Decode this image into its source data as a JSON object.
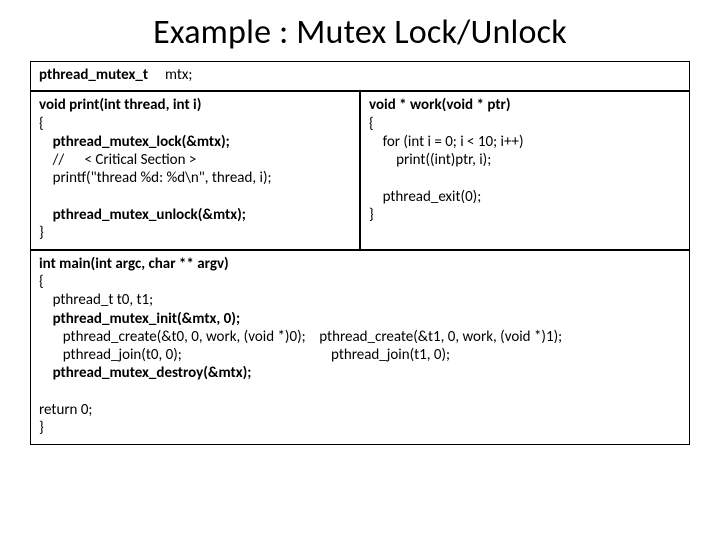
{
  "title": "Example : Mutex Lock/Unlock",
  "decl_type": "pthread_mutex_t",
  "decl_var": "mtx;",
  "print_fn": {
    "sig": "void print(int thread, int i)",
    "open": "{",
    "l1": "    pthread_mutex_lock(&mtx);",
    "l2": "    //      < Critical Section >",
    "l3": "    printf(\"thread %d: %d\\n\", thread, i);",
    "l4": "",
    "l5": "    pthread_mutex_unlock(&mtx);",
    "close": "}"
  },
  "work_fn": {
    "sig": "void * work(void * ptr)",
    "open": "{",
    "l1": "    for (int i = 0; i < 10; i++)",
    "l2": "        print((int)ptr, i);",
    "l3": "",
    "l4": "    pthread_exit(0);",
    "close": "}"
  },
  "main_fn": {
    "sig": "int main(int argc, char ** argv)",
    "open": "{",
    "l1": "    pthread_t t0, t1;",
    "l2": "    pthread_mutex_init(&mtx, 0);",
    "l3a": "       pthread_create(&t0, 0, work, (void *)0);",
    "l3b": "pthread_create(&t1, 0, work, (void *)1);",
    "l4a": "       pthread_join(t0, 0);",
    "l4b": "pthread_join(t1, 0);",
    "l5": "    pthread_mutex_destroy(&mtx);",
    "l6": "",
    "ret": "return 0;",
    "close": "}"
  }
}
